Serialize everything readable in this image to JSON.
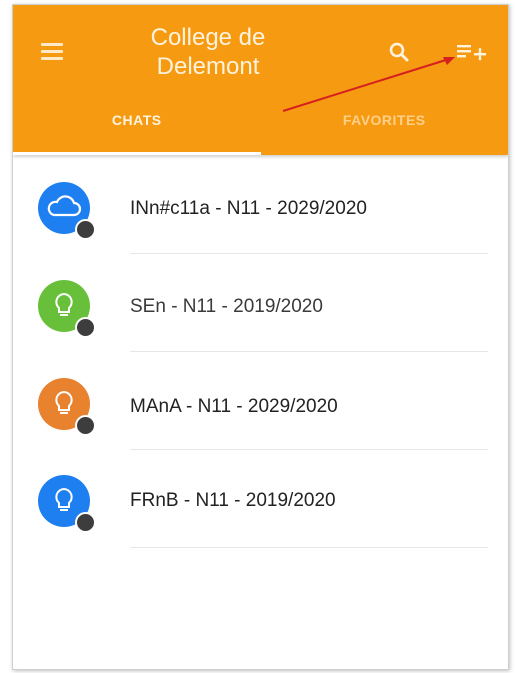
{
  "app_bar": {
    "title_line1": "College de",
    "title_line2": "Delemont",
    "background": "#f69a11",
    "menu_icon": "hamburger-menu-icon",
    "search_icon": "search-icon",
    "add_icon": "playlist-add-icon"
  },
  "tabs": [
    {
      "label": "CHATS",
      "selected": true
    },
    {
      "label": "FAVORITES",
      "selected": false
    }
  ],
  "chats": [
    {
      "name": "INn#c11a - N11 - 2029/2020",
      "avatar_color": "#1e7ff0",
      "icon": "cloud-icon",
      "locked": true
    },
    {
      "name": "SEn - N11 - 2019/2020",
      "avatar_color": "#68c03a",
      "icon": "lightbulb-icon",
      "locked": true
    },
    {
      "name": "MAnA - N11 - 2029/2020",
      "avatar_color": "#e8822f",
      "icon": "lightbulb-icon",
      "locked": true
    },
    {
      "name": "FRnB - N11 - 2019/2020",
      "avatar_color": "#1e7ff0",
      "icon": "lightbulb-icon",
      "locked": true
    }
  ],
  "annotation": {
    "type": "red-arrow",
    "color": "#d62020",
    "points_to": "playlist-add-icon"
  }
}
